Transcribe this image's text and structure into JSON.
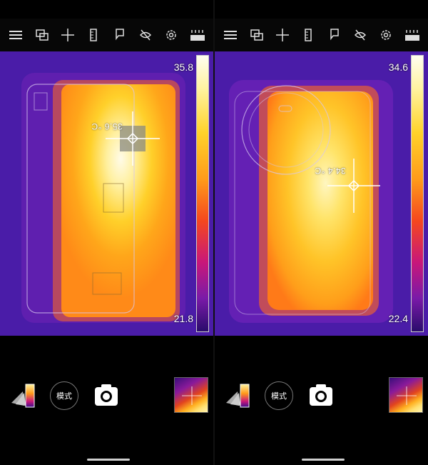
{
  "toolbar": {
    "icons": [
      "menu-icon",
      "layers-icon",
      "crosshair-icon",
      "ruler-icon",
      "flag-icon",
      "hide-icon",
      "settings-icon",
      "brightness-icon"
    ]
  },
  "left": {
    "scale_max": "35.8",
    "scale_min": "21.8",
    "spot_reading": "35.6 °C",
    "mode_label": "模式"
  },
  "right": {
    "scale_max": "34.6",
    "scale_min": "22.4",
    "spot_reading": "34.4 °C",
    "mode_label": "模式"
  },
  "colors": {
    "background": "#000000",
    "cold": "#4a1ca8",
    "hot": "#fff6d0"
  }
}
